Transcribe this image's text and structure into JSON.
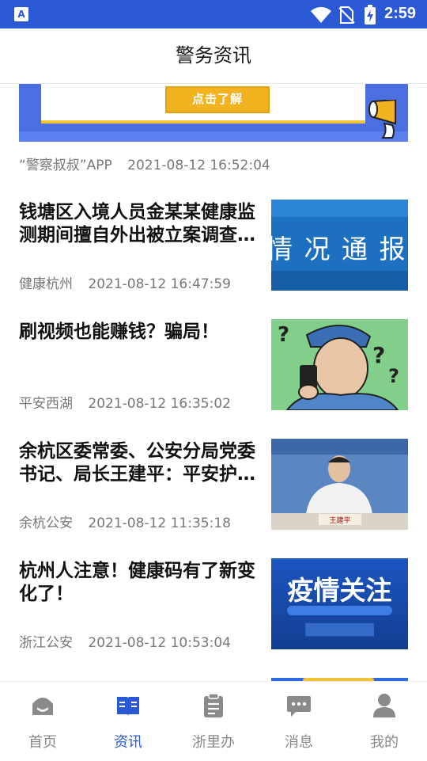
{
  "status_bar": {
    "time": "2:59",
    "app_badge": "A"
  },
  "header": {
    "title": "警务资讯"
  },
  "banner": {
    "button_label": "点击了解",
    "source": "“警察叔叔”APP",
    "time": "2021-08-12 16:52:04"
  },
  "articles": [
    {
      "title": "钱塘区入境人员金某某健康监测期间擅自外出被立案调查…",
      "source": "健康杭州",
      "time": "2021-08-12 16:47:59",
      "thumb_text": "情 况 通 报"
    },
    {
      "title": "刷视频也能赚钱？骗局！",
      "source": "平安西湖",
      "time": "2021-08-12 16:35:02",
      "thumb_text": ""
    },
    {
      "title": "余杭区委常委、公安分局党委书记、局长王建平：平安护…",
      "source": "余杭公安",
      "time": "2021-08-12 11:35:18",
      "thumb_text": "王建平"
    },
    {
      "title": "杭州人注意！健康码有了新变化了！",
      "source": "浙江公安",
      "time": "2021-08-12 10:53:04",
      "thumb_text": "疫情关注"
    }
  ],
  "tabs": [
    {
      "label": "首页",
      "icon": "home-icon",
      "active": false
    },
    {
      "label": "资讯",
      "icon": "news-book-icon",
      "active": true
    },
    {
      "label": "浙里办",
      "icon": "clipboard-icon",
      "active": false
    },
    {
      "label": "消息",
      "icon": "message-icon",
      "active": false
    },
    {
      "label": "我的",
      "icon": "profile-icon",
      "active": false
    }
  ],
  "colors": {
    "accent": "#2b59d6",
    "inactive": "#888888"
  }
}
